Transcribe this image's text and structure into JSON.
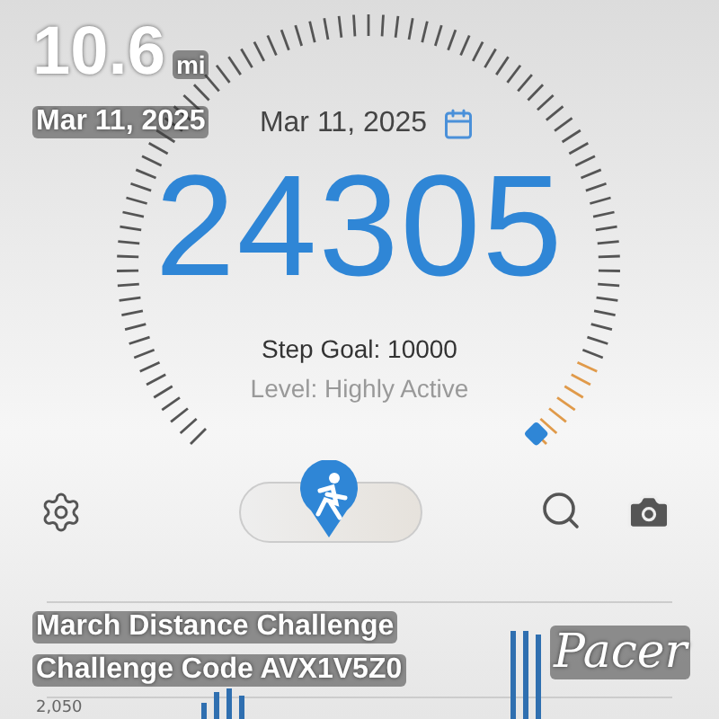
{
  "overlay": {
    "distance": "10.6",
    "distance_unit": "mi",
    "date": "Mar 11, 2025",
    "challenge_title": "March Distance Challenge",
    "challenge_code": "Challenge Code AVX1V5Z0",
    "brand": "Pacer"
  },
  "tracker": {
    "date": "Mar 11, 2025",
    "steps": "24305",
    "step_goal": "Step Goal: 10000",
    "activity_level": "Level: Highly Active"
  },
  "chart": {
    "axis_label": "2,050"
  }
}
